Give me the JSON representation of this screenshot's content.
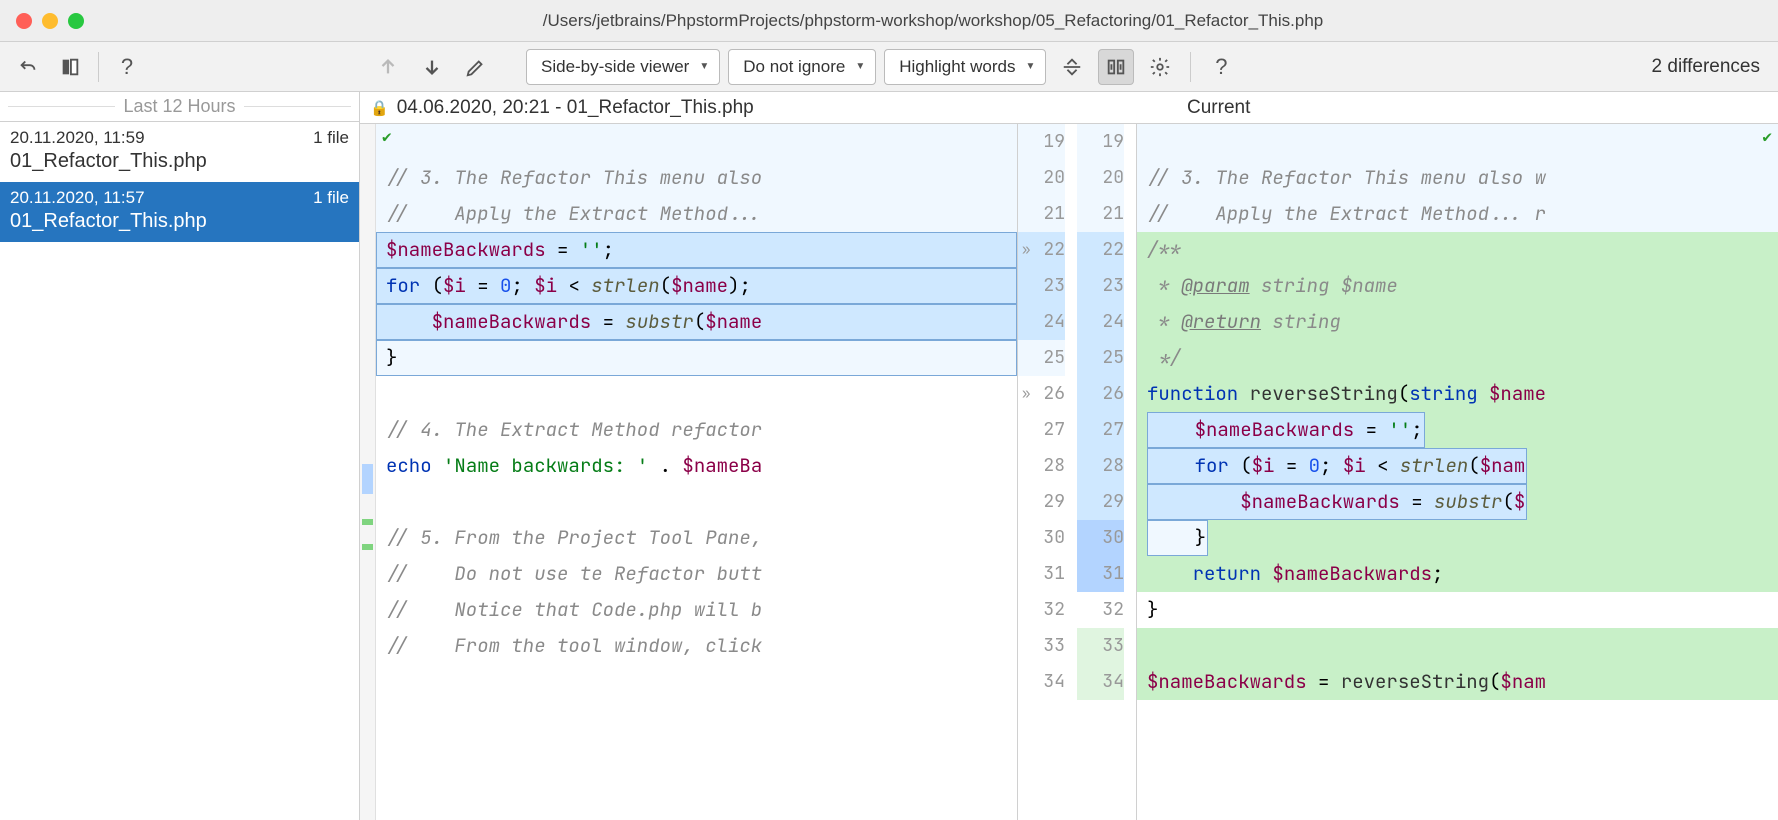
{
  "title": "/Users/jetbrains/PhpstormProjects/phpstorm-workshop/workshop/05_Refactoring/01_Refactor_This.php",
  "toolbar": {
    "viewer_mode": "Side-by-side viewer",
    "ignore_mode": "Do not ignore",
    "highlight_mode": "Highlight words",
    "diff_count": "2 differences"
  },
  "sidebar": {
    "header": "Last 12 Hours",
    "items": [
      {
        "ts": "20.11.2020, 11:59",
        "meta": "1 file",
        "file": "01_Refactor_This.php"
      },
      {
        "ts": "20.11.2020, 11:57",
        "meta": "1 file",
        "file": "01_Refactor_This.php"
      }
    ]
  },
  "diff": {
    "left_title": "04.06.2020, 20:21 - 01_Refactor_This.php",
    "right_title": "Current",
    "left_nums": [
      "19",
      "20",
      "21",
      "22",
      "23",
      "24",
      "25",
      "26",
      "27",
      "28",
      "29",
      "30",
      "31",
      "32",
      "33",
      "34"
    ],
    "right_nums": [
      "19",
      "20",
      "21",
      "22",
      "23",
      "24",
      "25",
      "26",
      "27",
      "28",
      "29",
      "30",
      "31",
      "32",
      "33",
      "34"
    ]
  },
  "left_code": {
    "l19": "",
    "l20": "// 3. The Refactor This menu also",
    "l21": "//    Apply the Extract Method...",
    "l22_a": "$nameBackwards",
    "l22_b": " = ",
    "l22_c": "''",
    "l22_d": ";",
    "l23_a": "for ",
    "l23_b": "(",
    "l23_c": "$i",
    "l23_d": " = ",
    "l23_e": "0",
    "l23_f": "; ",
    "l23_g": "$i",
    "l23_h": " < ",
    "l23_i": "strlen",
    "l23_j": "(",
    "l23_k": "$name",
    "l23_l": ");",
    "l24_a": "    ",
    "l24_b": "$nameBackwards",
    "l24_c": " = ",
    "l24_d": "substr",
    "l24_e": "(",
    "l24_f": "$name",
    "l25": "}",
    "l26": "",
    "l27": "// 4. The Extract Method refactor",
    "l28_a": "echo ",
    "l28_b": "'Name backwards: '",
    "l28_c": " . ",
    "l28_d": "$nameBa",
    "l29": "",
    "l30": "// 5. From the Project Tool Pane,",
    "l31": "//    Do not use te Refactor butt",
    "l32": "//    Notice that Code.php will b",
    "l33": "//    From the tool window, click",
    "l34": ""
  },
  "right_code": {
    "r19": "",
    "r20": "// 3. The Refactor This menu also w",
    "r21": "//    Apply the Extract Method... r",
    "r22": "/**",
    "r23_a": " * ",
    "r23_b": "@param",
    "r23_c": " string ",
    "r23_d": "$name",
    "r24_a": " * ",
    "r24_b": "@return",
    "r24_c": " string",
    "r25": " */",
    "r26_a": "function ",
    "r26_b": "reverseString",
    "r26_c": "(",
    "r26_d": "string ",
    "r26_e": "$name",
    "r27_a": "    ",
    "r27_b": "$nameBackwards",
    "r27_c": " = ",
    "r27_d": "''",
    "r27_e": ";",
    "r28_a": "    ",
    "r28_b": "for ",
    "r28_c": "(",
    "r28_d": "$i",
    "r28_e": " = ",
    "r28_f": "0",
    "r28_g": "; ",
    "r28_h": "$i",
    "r28_i": " < ",
    "r28_j": "strlen",
    "r28_k": "(",
    "r28_l": "$nam",
    "r29_a": "        ",
    "r29_b": "$nameBackwards",
    "r29_c": " = ",
    "r29_d": "substr",
    "r29_e": "(",
    "r29_f": "$",
    "r30": "    }",
    "r31_a": "    ",
    "r31_b": "return ",
    "r31_c": "$nameBackwards",
    "r31_d": ";",
    "r32": "}",
    "r33": "",
    "r34_a": "$nameBackwards",
    "r34_b": " = ",
    "r34_c": "reverseString",
    "r34_d": "(",
    "r34_e": "$nam"
  }
}
